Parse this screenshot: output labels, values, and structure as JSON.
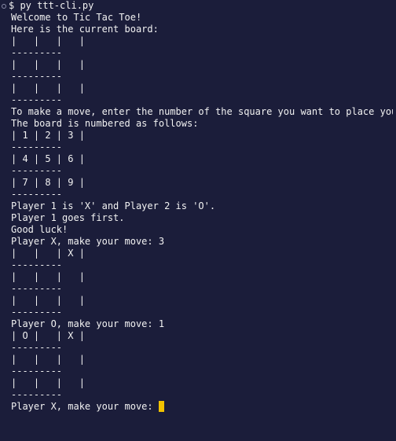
{
  "terminal": {
    "command": "$ py ttt-cli.py",
    "lines": [
      "Welcome to Tic Tac Toe!",
      "Here is the current board:",
      "|   |   |   |",
      "---------",
      "|   |   |   |",
      "---------",
      "|   |   |   |",
      "---------",
      "To make a move, enter the number of the square you want to place your piece in.",
      "The board is numbered as follows:",
      "| 1 | 2 | 3 |",
      "---------",
      "| 4 | 5 | 6 |",
      "---------",
      "| 7 | 8 | 9 |",
      "---------",
      "Player 1 is 'X' and Player 2 is 'O'.",
      "Player 1 goes first.",
      "Good luck!",
      "Player X, make your move: 3",
      "|   |   | X |",
      "---------",
      "|   |   |   |",
      "---------",
      "|   |   |   |",
      "---------",
      "Player O, make your move: 1",
      "| O |   | X |",
      "---------",
      "|   |   |   |",
      "---------",
      "|   |   |   |",
      "---------"
    ],
    "input_prompt": "Player X, make your move: ",
    "cursor_color": "#f2c200",
    "background_color": "#1b1d3a"
  }
}
